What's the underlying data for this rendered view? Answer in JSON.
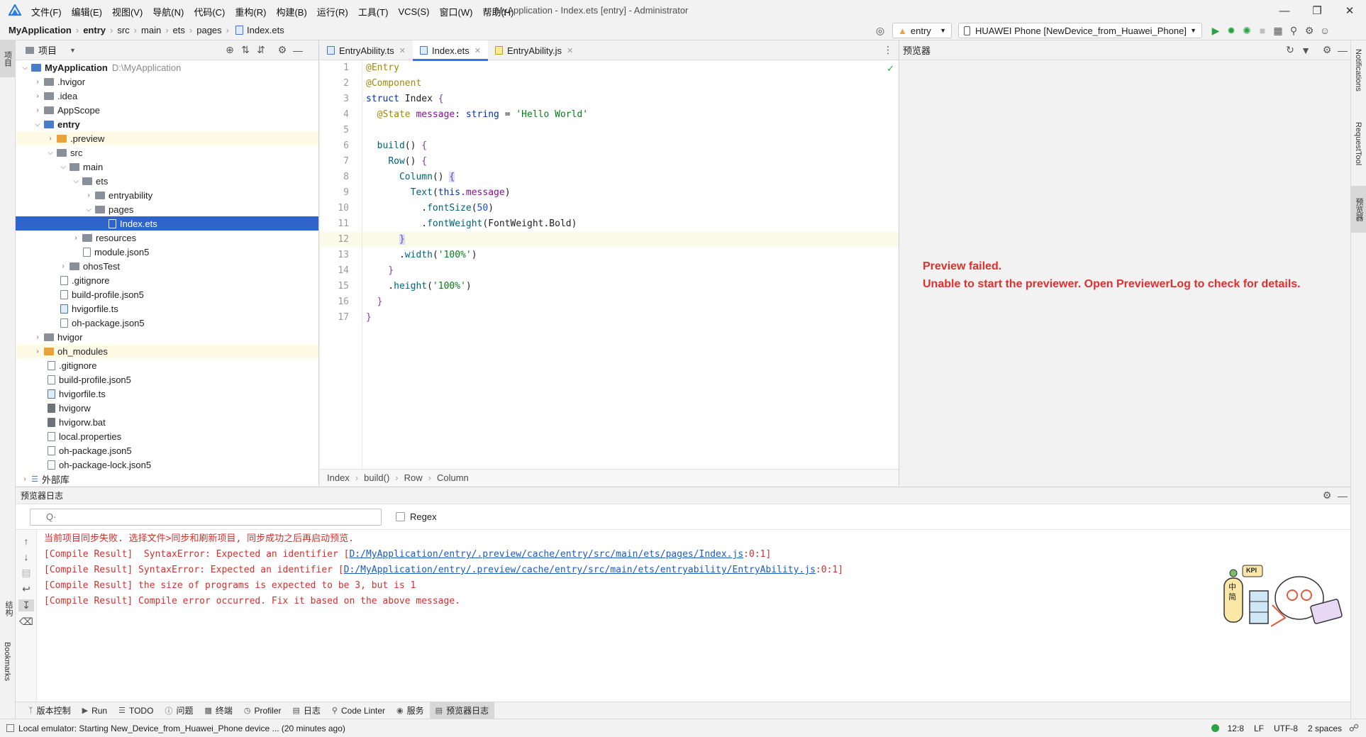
{
  "app": {
    "menu": [
      "文件(F)",
      "编辑(E)",
      "视图(V)",
      "导航(N)",
      "代码(C)",
      "重构(R)",
      "构建(B)",
      "运行(R)",
      "工具(T)",
      "VCS(S)",
      "窗口(W)",
      "帮助(H)"
    ],
    "title": "MyApplication - Index.ets [entry] - Administrator"
  },
  "nav": {
    "breadcrumbs": [
      "MyApplication",
      "entry",
      "src",
      "main",
      "ets",
      "pages",
      "Index.ets"
    ],
    "module": "entry",
    "device": "HUAWEI Phone [NewDevice_from_Huawei_Phone]"
  },
  "leftstrip": {
    "project": "项目",
    "structure": "结构",
    "bookmarks": "Bookmarks"
  },
  "rightstrip": {
    "notifications": "Notifications",
    "requesttool": "RequestTool",
    "previewer": "预览器"
  },
  "project": {
    "title": "项目",
    "tree": [
      {
        "label": "MyApplication",
        "hint": "D:\\MyApplication"
      },
      {
        "label": ".hvigor"
      },
      {
        "label": ".idea"
      },
      {
        "label": "AppScope"
      },
      {
        "label": "entry"
      },
      {
        "label": ".preview"
      },
      {
        "label": "src"
      },
      {
        "label": "main"
      },
      {
        "label": "ets"
      },
      {
        "label": "entryability"
      },
      {
        "label": "pages"
      },
      {
        "label": "Index.ets"
      },
      {
        "label": "resources"
      },
      {
        "label": "module.json5"
      },
      {
        "label": "ohosTest"
      },
      {
        "label": ".gitignore"
      },
      {
        "label": "build-profile.json5"
      },
      {
        "label": "hvigorfile.ts"
      },
      {
        "label": "oh-package.json5"
      },
      {
        "label": "hvigor"
      },
      {
        "label": "oh_modules"
      },
      {
        "label": ".gitignore"
      },
      {
        "label": "build-profile.json5"
      },
      {
        "label": "hvigorfile.ts"
      },
      {
        "label": "hvigorw"
      },
      {
        "label": "hvigorw.bat"
      },
      {
        "label": "local.properties"
      },
      {
        "label": "oh-package.json5"
      },
      {
        "label": "oh-package-lock.json5"
      },
      {
        "label": "外部库"
      }
    ]
  },
  "editor": {
    "tabs": [
      "EntryAbility.ts",
      "Index.ets",
      "EntryAbility.js"
    ],
    "line_numbers": [
      "1",
      "2",
      "3",
      "4",
      "5",
      "6",
      "7",
      "8",
      "9",
      "10",
      "11",
      "12",
      "13",
      "14",
      "15",
      "16",
      "17"
    ],
    "code": {
      "l1": "@Entry",
      "l2": "@Component",
      "l3a": "struct",
      "l3b": " Index ",
      "l3c": "{",
      "l4a": "  @State",
      "l4b": " message",
      "l4c": ": ",
      "l4d": "string",
      "l4e": " = ",
      "l4f": "'Hello World'",
      "l6a": "  ",
      "l6b": "build",
      "l6c": "() ",
      "l6d": "{",
      "l7a": "    ",
      "l7b": "Row",
      "l7c": "() ",
      "l7d": "{",
      "l8a": "      ",
      "l8b": "Column",
      "l8c": "() ",
      "l8d": "{",
      "l9a": "        ",
      "l9b": "Text",
      "l9c": "(",
      "l9d": "this",
      "l9e": ".message",
      "l9f": ")",
      "l10a": "          .",
      "l10b": "fontSize",
      "l10c": "(",
      "l10d": "50",
      "l10e": ")",
      "l11a": "          .",
      "l11b": "fontWeight",
      "l11c": "(FontWeight.Bold)",
      "l12a": "      ",
      "l12b": "}",
      "l13a": "      .",
      "l13b": "width",
      "l13c": "(",
      "l13d": "'100%'",
      "l13e": ")",
      "l14": "    }",
      "l15a": "    .",
      "l15b": "height",
      "l15c": "(",
      "l15d": "'100%'",
      "l15e": ")",
      "l16": "  }",
      "l17": "}"
    },
    "breadcrumb": [
      "Index",
      "build()",
      "Row",
      "Column"
    ]
  },
  "preview": {
    "title": "预览器",
    "error1": "Preview failed.",
    "error2": "Unable to start the previewer. Open PreviewerLog to check for details."
  },
  "log": {
    "title": "预览器日志",
    "search_placeholder": "Q·",
    "regex": "Regex",
    "lines": [
      {
        "text": "当前项目同步失败. 选择文件>同步和刷新项目, 同步成功之后再启动预览."
      },
      {
        "pre": "[Compile Result]  SyntaxError: Expected an identifier [",
        "link": "D:/MyApplication/entry/.preview/cache/entry/src/main/ets/pages/Index.js",
        "post": ":0:1]"
      },
      {
        "pre": "[Compile Result] SyntaxError: Expected an identifier [",
        "link": "D:/MyApplication/entry/.preview/cache/entry/src/main/ets/entryability/EntryAbility.js",
        "post": ":0:1]"
      },
      {
        "text": "[Compile Result] the size of programs is expected to be 3, but is 1"
      },
      {
        "text": "[Compile Result] Compile error occurred. Fix it based on the above message."
      }
    ],
    "mascot_badge": "KPI",
    "mascot_text": "中简"
  },
  "tooltabs": [
    "版本控制",
    "Run",
    "TODO",
    "问题",
    "终端",
    "Profiler",
    "日志",
    "Code Linter",
    "服务",
    "预览器日志"
  ],
  "status": {
    "message": "Local emulator: Starting New_Device_from_Huawei_Phone device ... (20 minutes ago)",
    "position": "12:8",
    "line_sep": "LF",
    "encoding": "UTF-8",
    "indent": "2 spaces"
  },
  "colors": {
    "accent": "#3574f0",
    "selection": "#2f65ca",
    "error": "#e02f2f",
    "run": "#2aa345"
  }
}
